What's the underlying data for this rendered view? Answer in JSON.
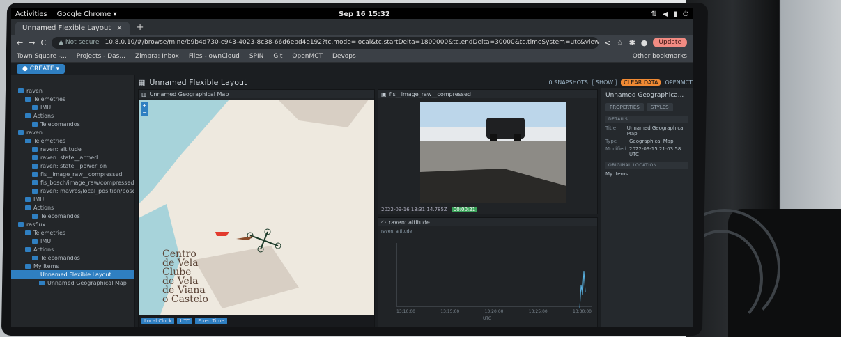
{
  "gnome": {
    "activities": "Activities",
    "app": "Google Chrome ▾",
    "clock": "Sep 16  15:32"
  },
  "browser": {
    "tab_title": "Unnamed Flexible Layout",
    "tab_close": "×",
    "tab_add": "+",
    "nav_back": "←",
    "nav_forward": "→",
    "nav_reload": "C",
    "not_secure": "▲ Not secure",
    "url": "10.8.0.10/#/browse/mine/b9b4d730-c943-4023-8c38-66d6ebd4e192?tc.mode=local&tc.startDelta=1800000&tc.endDelta=30000&tc.timeSystem=utc&view=flexible-layout",
    "update": "Update",
    "bookmarks": [
      "Town Square -...",
      "Projects - Das...",
      "Zimbra: Inbox",
      "Files - ownCloud",
      "SPIN",
      "Git",
      "OpenMCT",
      "Devops"
    ],
    "other_bookmarks": "Other bookmarks"
  },
  "app": {
    "create": "● CREATE ▾",
    "tree": [
      {
        "label": "raven",
        "indent": 0
      },
      {
        "label": "Telemetries",
        "indent": 1
      },
      {
        "label": "IMU",
        "indent": 2
      },
      {
        "label": "Actions",
        "indent": 1
      },
      {
        "label": "Telecomandos",
        "indent": 2
      },
      {
        "label": "raven",
        "indent": 0
      },
      {
        "label": "Telemetries",
        "indent": 1
      },
      {
        "label": "raven: altitude",
        "indent": 2
      },
      {
        "label": "raven: state__armed",
        "indent": 2
      },
      {
        "label": "raven: state__power_on",
        "indent": 2
      },
      {
        "label": "fis__image_raw__compressed",
        "indent": 2
      },
      {
        "label": "fis_bosch/image_raw/compressed",
        "indent": 2
      },
      {
        "label": "raven: mavros/local_position/pose",
        "indent": 2
      },
      {
        "label": "IMU",
        "indent": 1
      },
      {
        "label": "Actions",
        "indent": 1
      },
      {
        "label": "Telecomandos",
        "indent": 2
      },
      {
        "label": "rasflux",
        "indent": 0
      },
      {
        "label": "Telemetries",
        "indent": 1
      },
      {
        "label": "IMU",
        "indent": 2
      },
      {
        "label": "Actions",
        "indent": 1
      },
      {
        "label": "Telecomandos",
        "indent": 2
      },
      {
        "label": "My Items",
        "indent": 1
      },
      {
        "label": "Unnamed Flexible Layout",
        "indent": 2,
        "selected": true
      },
      {
        "label": "Unnamed Geographical Map",
        "indent": 3
      }
    ],
    "layout_title": "Unnamed Flexible Layout",
    "snapshots": "0 SNAPSHOTS",
    "show": "SHOW",
    "clear_data": "CLEAR DATA",
    "brand": "OPENMCT",
    "map_pane": {
      "title": "Unnamed Geographical Map",
      "place_lines": [
        "Centro",
        "de Vela",
        "Clube",
        "de Vela",
        "de Viana",
        "o Castelo"
      ],
      "footer": [
        "Local Clock",
        "UTC",
        "Fixed Time"
      ]
    },
    "image_pane": {
      "title": "fis__image_raw__compressed",
      "timestamp": "2022-09-16 13:31:14.785Z",
      "badge": "00:00:21"
    },
    "plot_pane": {
      "title": "raven: altitude",
      "legend": "raven: altitude",
      "ticks": [
        "13:10:00",
        "13:15:00",
        "13:20:00",
        "13:25:00",
        "13:30:00"
      ],
      "axis": "UTC"
    },
    "inspector": {
      "title": "Unnamed Geographica...",
      "tabs": [
        "PROPERTIES",
        "STYLES"
      ],
      "details": "DETAILS",
      "rows": [
        {
          "k": "Title",
          "v": "Unnamed Geographical Map"
        },
        {
          "k": "Type",
          "v": "Geographical Map"
        },
        {
          "k": "Modified",
          "v": "2022-09-15 21:03:58 UTC"
        }
      ],
      "original_location": "ORIGINAL LOCATION",
      "location": "My Items"
    }
  }
}
